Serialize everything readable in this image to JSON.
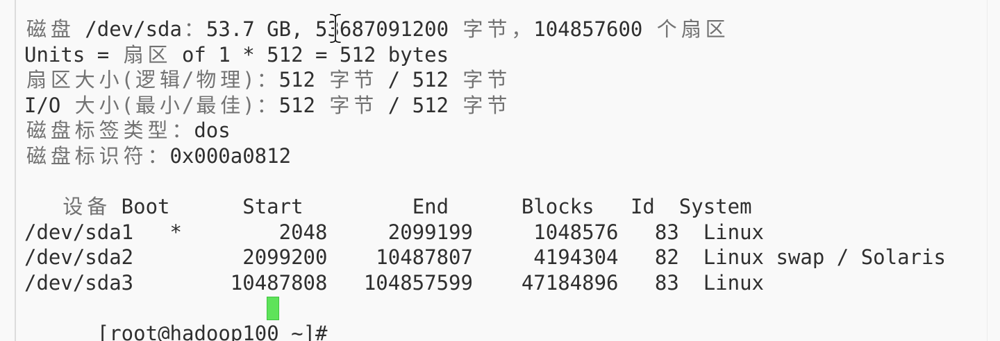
{
  "colors": {
    "background": "#f9f9f9",
    "text": "#2f2f2f",
    "cjk_text": "#727272",
    "cursor": "#5ee35a"
  },
  "disk_info": {
    "summary": "磁盘 /dev/sda：53.7 GB, 53687091200 字节，104857600 个扇区",
    "units": "Units = 扇区 of 1 * 512 = 512 bytes",
    "sector_size": "扇区大小(逻辑/物理)：512 字节 / 512 字节",
    "io_size": "I/O 大小(最小/最佳)：512 字节 / 512 字节",
    "label_type": "磁盘标签类型：dos",
    "identifier": "磁盘标识符：0x000a0812"
  },
  "partition_table": {
    "headers": {
      "device": "设备",
      "boot": "Boot",
      "start": "Start",
      "end": "End",
      "blocks": "Blocks",
      "id": "Id",
      "system": "System"
    },
    "rows": [
      {
        "device": "/dev/sda1",
        "boot": "*",
        "start": "2048",
        "end": "2099199",
        "blocks": "1048576",
        "id": "83",
        "system": "Linux"
      },
      {
        "device": "/dev/sda2",
        "boot": "",
        "start": "2099200",
        "end": "10487807",
        "blocks": "4194304",
        "id": "82",
        "system": "Linux swap / Solaris"
      },
      {
        "device": "/dev/sda3",
        "boot": "",
        "start": "10487808",
        "end": "104857599",
        "blocks": "47184896",
        "id": "83",
        "system": "Linux"
      }
    ]
  },
  "prompt": {
    "text": "[root@hadoop100 ~]#"
  },
  "icons": {
    "mouse_pointer": "i-beam-cursor-icon",
    "text_cursor": "block-cursor"
  }
}
